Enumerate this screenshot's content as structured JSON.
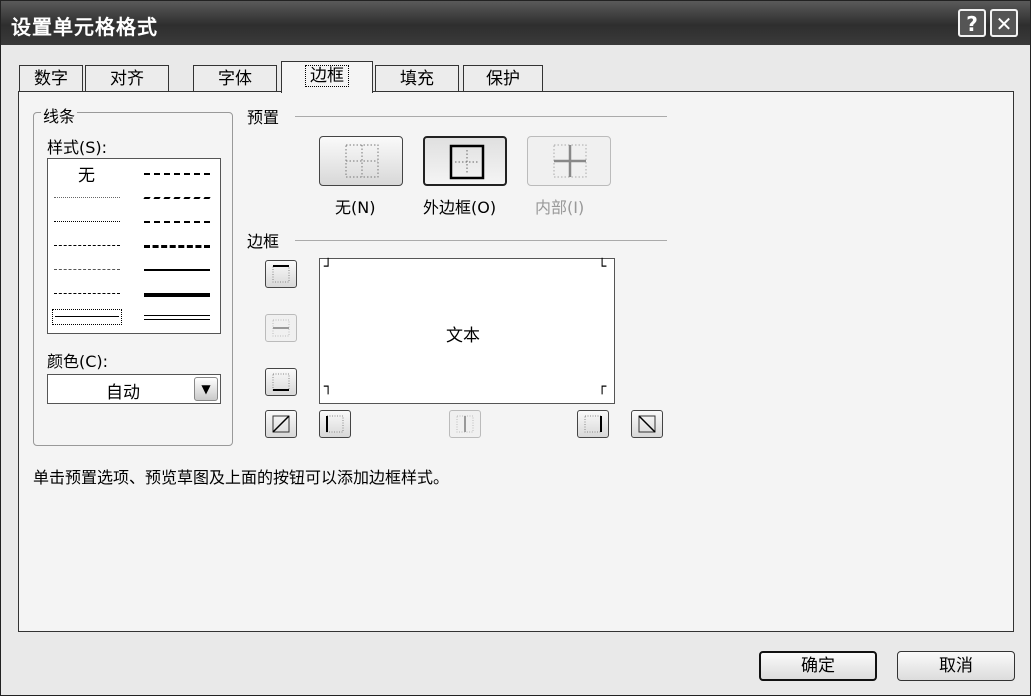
{
  "window": {
    "title": "设置单元格格式",
    "help_glyph": "?",
    "close_glyph": "✕"
  },
  "tabs": [
    "数字",
    "对齐",
    "字体",
    "边框",
    "填充",
    "保护"
  ],
  "active_tab": "边框",
  "line_group": {
    "legend": "线条",
    "style_label": "样式(S):",
    "none_label": "无",
    "color_label": "颜色(C):",
    "color_value": "自动"
  },
  "presets": {
    "legend": "预置",
    "none": "无(N)",
    "outline": "外边框(O)",
    "inside": "内部(I)"
  },
  "border": {
    "legend": "边框",
    "preview_text": "文本"
  },
  "hint": "单击预置选项、预览草图及上面的按钮可以添加边框样式。",
  "buttons": {
    "ok": "确定",
    "cancel": "取消"
  }
}
